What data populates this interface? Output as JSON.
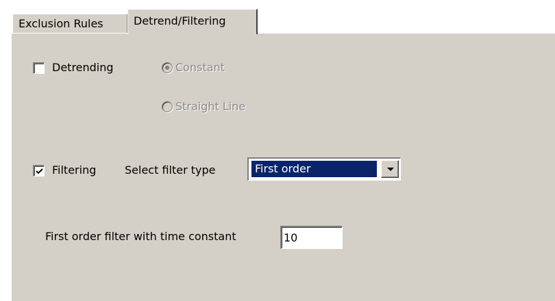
{
  "tabs": [
    {
      "label": "Exclusion Rules",
      "active": false
    },
    {
      "label": "Detrend/Filtering",
      "active": true
    }
  ],
  "detrending": {
    "label": "Detrending",
    "checked": false,
    "options": [
      {
        "label": "Constant",
        "selected": true,
        "enabled": false
      },
      {
        "label": "Straight Line",
        "selected": false,
        "enabled": false
      }
    ]
  },
  "filtering": {
    "label": "Filtering",
    "checked": true,
    "filter_type_label": "Select filter type",
    "filter_type_value": "First order"
  },
  "time_constant": {
    "label": "First order filter with time constant",
    "value": "10"
  },
  "colors": {
    "panel": "#d4d0c8",
    "selection": "#0a246a",
    "disabled_text": "#8a8a8a"
  }
}
